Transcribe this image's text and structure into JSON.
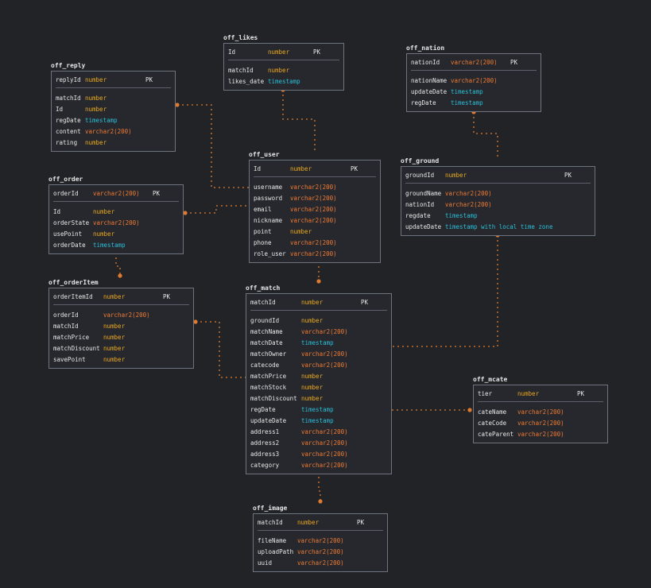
{
  "colors": {
    "background": "#222327",
    "connector": "#e07a2e",
    "number_type": "#e8a722",
    "varchar_type": "#ef7b35",
    "timestamp_type": "#2bbfd9",
    "text": "#e8e8e8",
    "border": "#6e7380"
  },
  "tables": [
    {
      "id": "off_likes",
      "name": "off_likes",
      "pk": {
        "name": "Id",
        "type": "number",
        "badge": "PK"
      },
      "fields": [
        {
          "name": "matchId",
          "type": "number"
        },
        {
          "name": "likes_date",
          "type": "timestamp"
        }
      ]
    },
    {
      "id": "off_reply",
      "name": "off_reply",
      "pk": {
        "name": "replyId",
        "type": "number",
        "badge": "PK"
      },
      "fields": [
        {
          "name": "matchId",
          "type": "number"
        },
        {
          "name": "Id",
          "type": "number"
        },
        {
          "name": "regDate",
          "type": "timestamp"
        },
        {
          "name": "content",
          "type": "varchar2(200)"
        },
        {
          "name": "rating",
          "type": "number"
        }
      ]
    },
    {
      "id": "off_nation",
      "name": "off_nation",
      "pk": {
        "name": "nationId",
        "type": "varchar2(200)",
        "badge": "PK"
      },
      "fields": [
        {
          "name": "nationName",
          "type": "varchar2(200)"
        },
        {
          "name": "updateDate",
          "type": "timestamp"
        },
        {
          "name": "regDate",
          "type": "timestamp"
        }
      ]
    },
    {
      "id": "off_user",
      "name": "off_user",
      "pk": {
        "name": "Id",
        "type": "number",
        "badge": "PK"
      },
      "fields": [
        {
          "name": "username",
          "type": "varchar2(200)"
        },
        {
          "name": "password",
          "type": "varchar2(200)"
        },
        {
          "name": "email",
          "type": "varchar2(200)"
        },
        {
          "name": "nickname",
          "type": "varchar2(200)"
        },
        {
          "name": "point",
          "type": "number"
        },
        {
          "name": "phone",
          "type": "varchar2(200)"
        },
        {
          "name": "role_user",
          "type": "varchar2(200)"
        }
      ]
    },
    {
      "id": "off_ground",
      "name": "off_ground",
      "pk": {
        "name": "groundId",
        "type": "number",
        "badge": "PK"
      },
      "fields": [
        {
          "name": "groundName",
          "type": "varchar2(200)"
        },
        {
          "name": "nationId",
          "type": "varchar2(200)"
        },
        {
          "name": "regdate",
          "type": "timestamp"
        },
        {
          "name": "updateDate",
          "type": "timestamp with local time zone"
        }
      ]
    },
    {
      "id": "off_order",
      "name": "off_order",
      "pk": {
        "name": "orderId",
        "type": "varchar2(200)",
        "badge": "PK"
      },
      "fields": [
        {
          "name": "Id",
          "type": "number"
        },
        {
          "name": "orderState",
          "type": "varchar2(200)"
        },
        {
          "name": "usePoint",
          "type": "number"
        },
        {
          "name": "orderDate",
          "type": "timestamp"
        }
      ]
    },
    {
      "id": "off_orderItem",
      "name": "off_orderItem",
      "pk": {
        "name": "orderItemId",
        "type": "number",
        "badge": "PK"
      },
      "fields": [
        {
          "name": "orderId",
          "type": "varchar2(200)"
        },
        {
          "name": "matchId",
          "type": "number"
        },
        {
          "name": "matchPrice",
          "type": "number"
        },
        {
          "name": "matchDiscount",
          "type": "number"
        },
        {
          "name": "savePoint",
          "type": "number"
        }
      ]
    },
    {
      "id": "off_match",
      "name": "off_match",
      "pk": {
        "name": "matchId",
        "type": "number",
        "badge": "PK"
      },
      "fields": [
        {
          "name": "groundId",
          "type": "number"
        },
        {
          "name": "matchName",
          "type": "varchar2(200)"
        },
        {
          "name": "matchDate",
          "type": "timestamp"
        },
        {
          "name": "matchOwner",
          "type": "varchar2(200)"
        },
        {
          "name": "catecode",
          "type": "varchar2(200)"
        },
        {
          "name": "matchPrice",
          "type": "number"
        },
        {
          "name": "matchStock",
          "type": "number"
        },
        {
          "name": "matchDiscount",
          "type": "number"
        },
        {
          "name": "regDate",
          "type": "timestamp"
        },
        {
          "name": "updateDate",
          "type": "timestamp"
        },
        {
          "name": "address1",
          "type": "varchar2(200)"
        },
        {
          "name": "address2",
          "type": "varchar2(200)"
        },
        {
          "name": "address3",
          "type": "varchar2(200)"
        },
        {
          "name": "category",
          "type": "varchar2(200)"
        }
      ]
    },
    {
      "id": "off_mcate",
      "name": "off_mcate",
      "pk": {
        "name": "tier",
        "type": "number",
        "badge": "PK"
      },
      "fields": [
        {
          "name": "cateName",
          "type": "varchar2(200)"
        },
        {
          "name": "cateCode",
          "type": "varchar2(200)"
        },
        {
          "name": "cateParent",
          "type": "varchar2(200)"
        }
      ]
    },
    {
      "id": "off_image",
      "name": "off_image",
      "pk": {
        "name": "matchId",
        "type": "number",
        "badge": "PK"
      },
      "fields": [
        {
          "name": "fileName",
          "type": "varchar2(200)"
        },
        {
          "name": "uploadPath",
          "type": "varchar2(200)"
        },
        {
          "name": "uuid",
          "type": "varchar2(200)"
        }
      ]
    }
  ],
  "relations": [
    {
      "from": "off_reply",
      "to": "off_user"
    },
    {
      "from": "off_likes",
      "to": "off_user"
    },
    {
      "from": "off_order",
      "to": "off_user"
    },
    {
      "from": "off_order",
      "to": "off_orderItem"
    },
    {
      "from": "off_orderItem",
      "to": "off_match"
    },
    {
      "from": "off_user",
      "to": "off_match"
    },
    {
      "from": "off_nation",
      "to": "off_ground"
    },
    {
      "from": "off_ground",
      "to": "off_match"
    },
    {
      "from": "off_match",
      "to": "off_mcate"
    },
    {
      "from": "off_match",
      "to": "off_image"
    }
  ]
}
